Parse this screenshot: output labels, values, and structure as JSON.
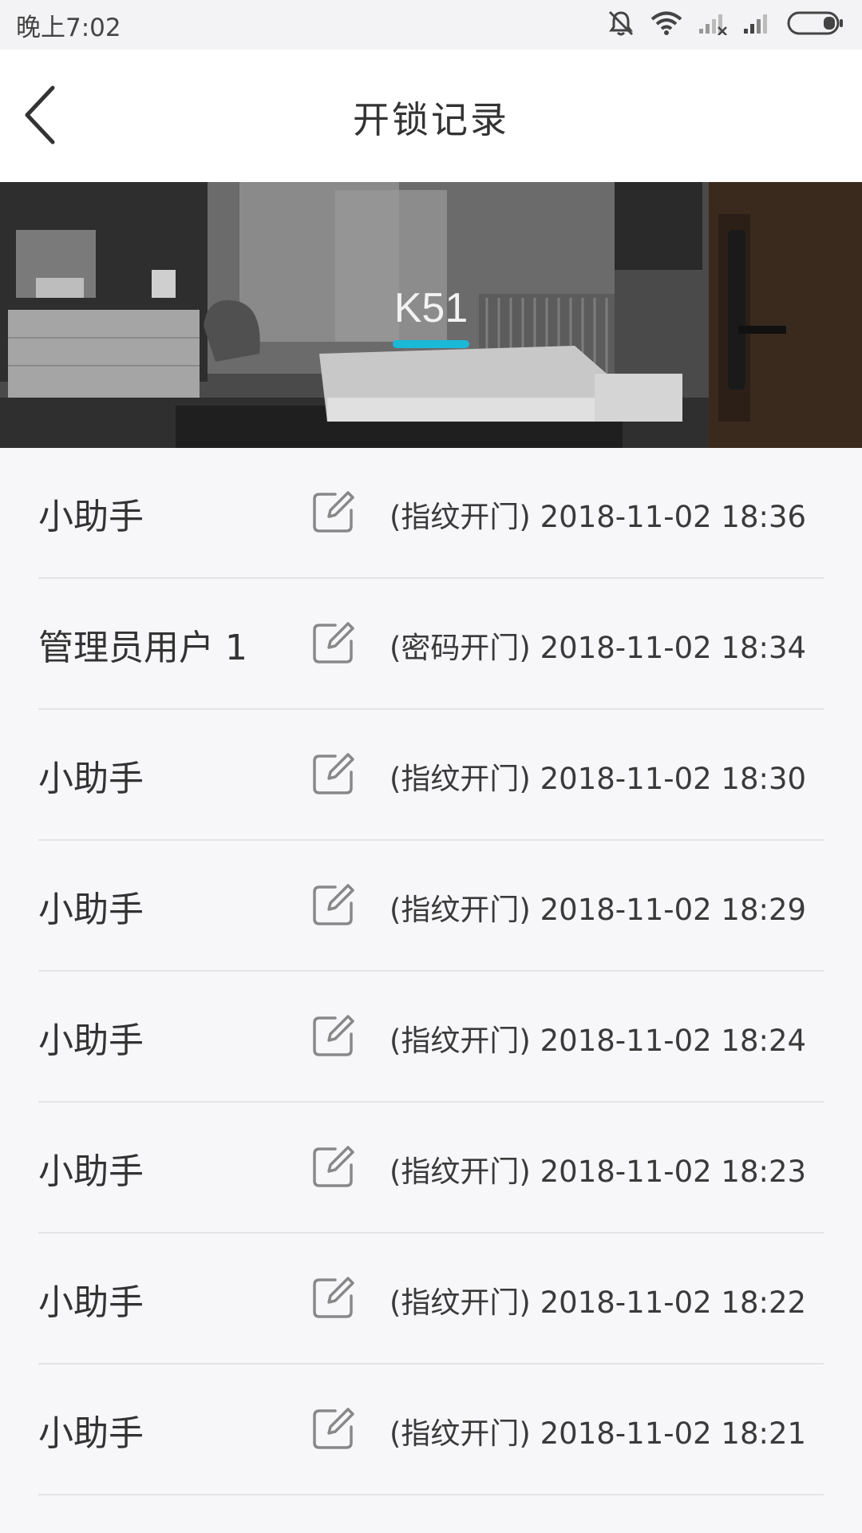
{
  "status_bar": {
    "time": "晚上7:02",
    "icons": [
      "mute-icon",
      "wifi-icon",
      "signal-icon",
      "signal-icon",
      "battery-icon"
    ]
  },
  "nav": {
    "title": "开锁记录",
    "back_icon": "back-arrow-icon"
  },
  "banner": {
    "device_name": "K51",
    "accent_color": "#1bb8d8"
  },
  "records": [
    {
      "user": "小助手",
      "method": "(指纹开门)",
      "datetime": "2018-11-02 18:36"
    },
    {
      "user": "管理员用户 1",
      "method": "(密码开门)",
      "datetime": "2018-11-02 18:34"
    },
    {
      "user": "小助手",
      "method": "(指纹开门)",
      "datetime": "2018-11-02 18:30"
    },
    {
      "user": "小助手",
      "method": "(指纹开门)",
      "datetime": "2018-11-02 18:29"
    },
    {
      "user": "小助手",
      "method": "(指纹开门)",
      "datetime": "2018-11-02 18:24"
    },
    {
      "user": "小助手",
      "method": "(指纹开门)",
      "datetime": "2018-11-02 18:23"
    },
    {
      "user": "小助手",
      "method": "(指纹开门)",
      "datetime": "2018-11-02 18:22"
    },
    {
      "user": "小助手",
      "method": "(指纹开门)",
      "datetime": "2018-11-02 18:21"
    }
  ]
}
